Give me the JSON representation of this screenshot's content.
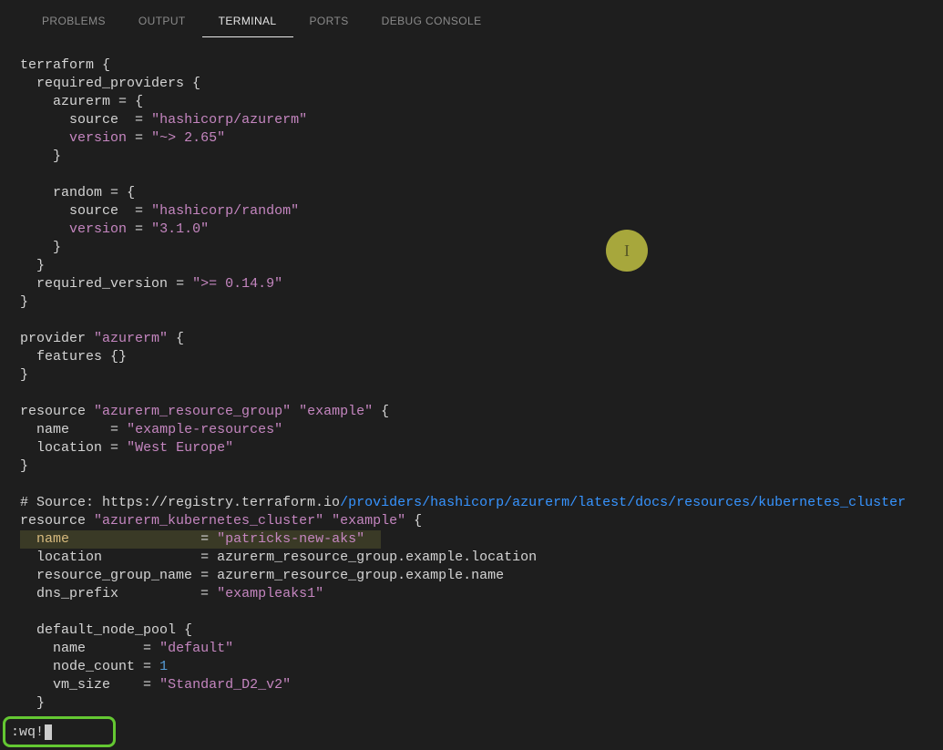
{
  "tabs": {
    "problems": "PROBLEMS",
    "output": "OUTPUT",
    "terminal": "TERMINAL",
    "ports": "PORTS",
    "debug": "DEBUG CONSOLE",
    "active": "terminal"
  },
  "cursor_marker": "I",
  "vim_cmd": ":wq!",
  "code": {
    "terraform_kw": "terraform",
    "required_providers_kw": "required_providers",
    "azurerm_key": "azurerm",
    "random_key": "random",
    "source_kw": "source",
    "version_kw": "version",
    "azurerm_src": "\"hashicorp/azurerm\"",
    "azurerm_ver": "\"~> 2.65\"",
    "random_src": "\"hashicorp/random\"",
    "random_ver": "\"3.1.0\"",
    "required_version_kw": "required_version",
    "required_version_val": "\">= 0.14.9\"",
    "provider_kw": "provider",
    "provider_name": "\"azurerm\"",
    "features_kw": "features",
    "resource_kw": "resource",
    "rg_type": "\"azurerm_resource_group\"",
    "rg_name": "\"example\"",
    "name_kw": "name",
    "rg_name_val": "\"example-resources\"",
    "location_kw": "location",
    "rg_loc_val": "\"West Europe\"",
    "comment_prefix": "# Source: https://registry.terraform.io",
    "comment_url": "/providers/hashicorp/azurerm/latest/docs/resources/kubernetes_cluster",
    "aks_type": "\"azurerm_kubernetes_cluster\"",
    "aks_name": "\"example\"",
    "aks_name_val": "\"patricks-new-aks\"",
    "aks_loc_ref": "azurerm_resource_group.example.location",
    "rgname_kw": "resource_group_name",
    "aks_rg_ref": "azurerm_resource_group.example.name",
    "dns_kw": "dns_prefix",
    "dns_val": "\"exampleaks1\"",
    "pool_kw": "default_node_pool",
    "pool_name_val": "\"default\"",
    "node_count_kw": "node_count",
    "node_count_val": "1",
    "vm_size_kw": "vm_size",
    "vm_size_val": "\"Standard_D2_v2\""
  }
}
